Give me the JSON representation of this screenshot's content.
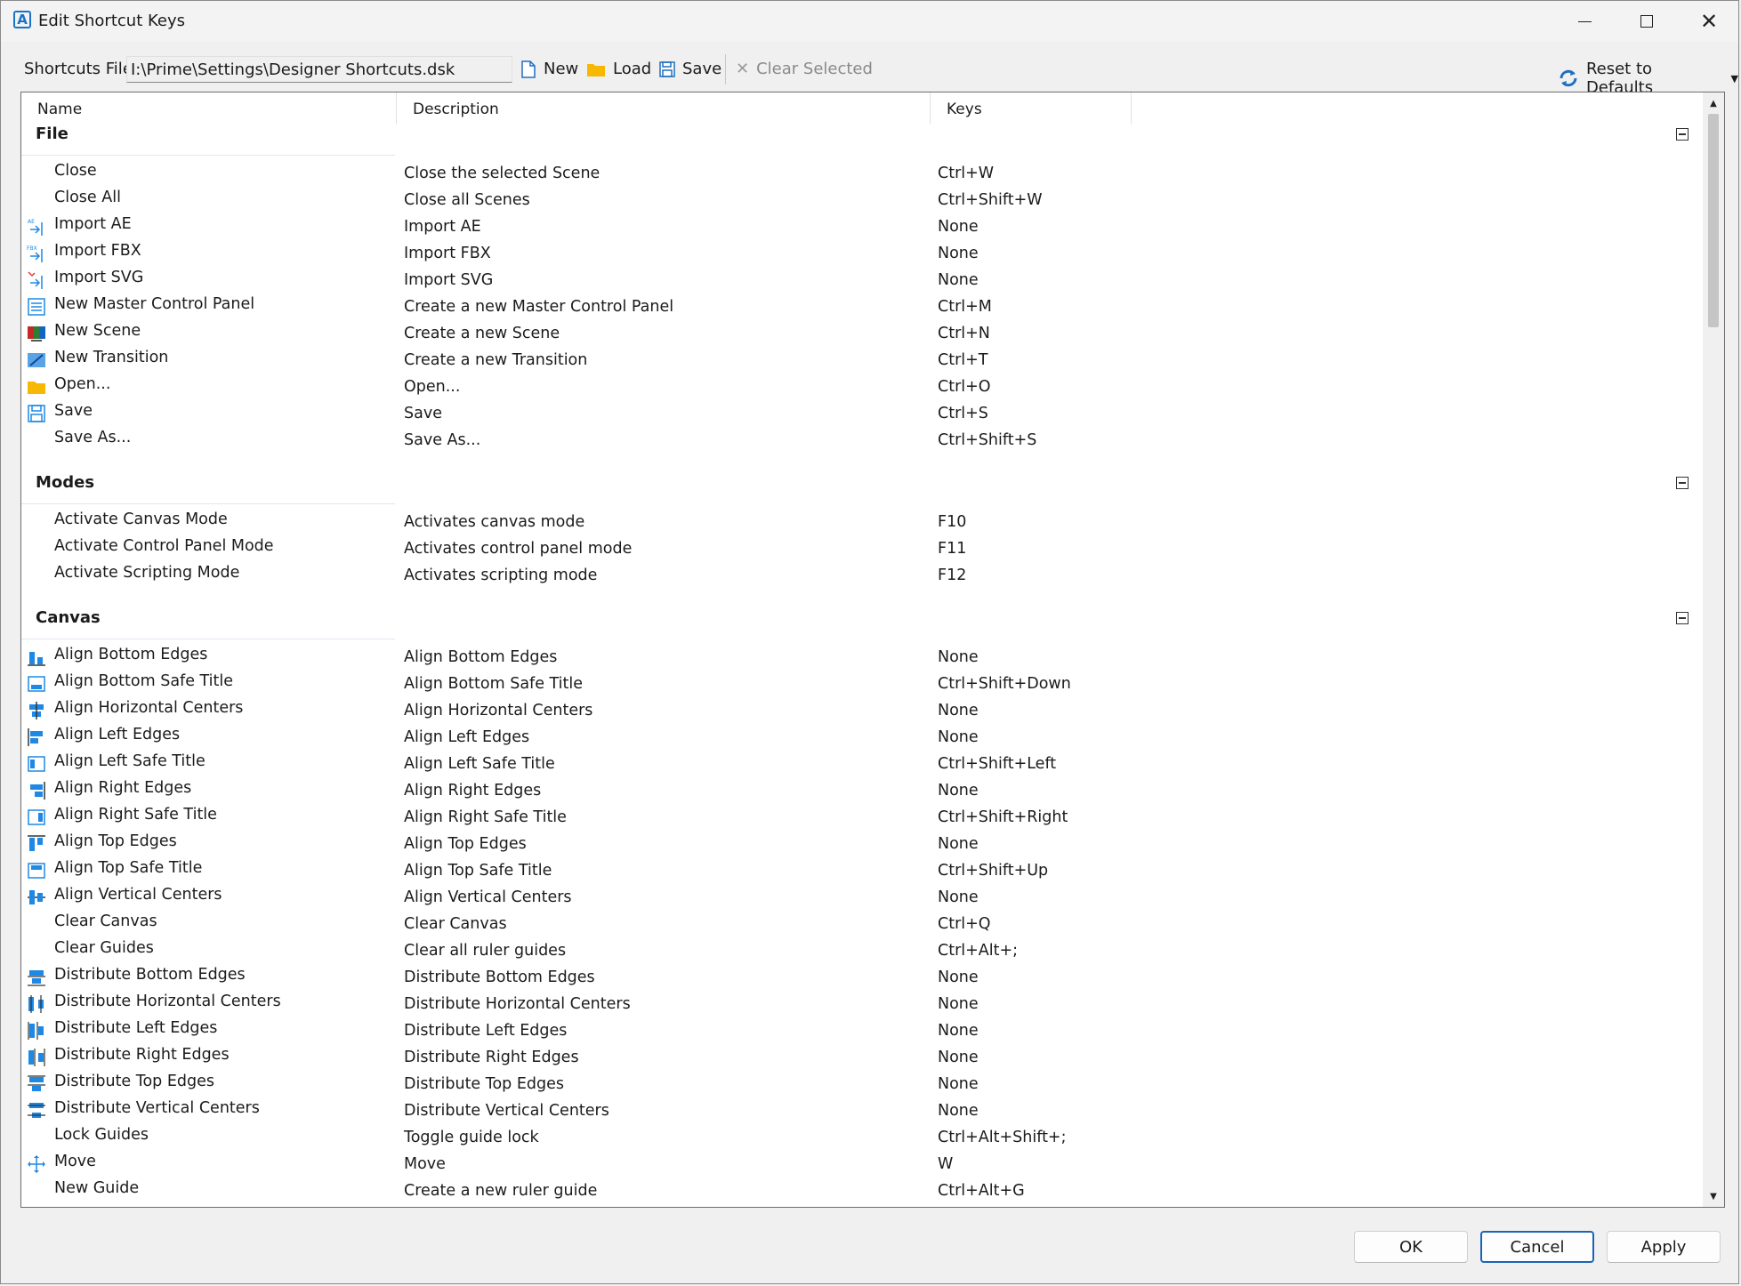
{
  "window": {
    "title": "Edit Shortcut Keys"
  },
  "toolbar": {
    "shortcuts_file_label": "Shortcuts File",
    "shortcuts_file_value": "I:\\Prime\\Settings\\Designer Shortcuts.dsk",
    "new_label": "New",
    "load_label": "Load",
    "save_label": "Save",
    "clear_selected_label": "Clear Selected",
    "reset_label": "Reset to Defaults"
  },
  "columns": {
    "name": "Name",
    "description": "Description",
    "keys": "Keys"
  },
  "groups": [
    {
      "title": "File",
      "rows": [
        {
          "icon": "",
          "name": "Close",
          "description": "Close the selected Scene",
          "keys": "Ctrl+W"
        },
        {
          "icon": "",
          "name": "Close All",
          "description": "Close all Scenes",
          "keys": "Ctrl+Shift+W"
        },
        {
          "icon": "import-ae-icon",
          "name": "Import AE",
          "description": "Import AE",
          "keys": "None"
        },
        {
          "icon": "import-fbx-icon",
          "name": "Import FBX",
          "description": "Import FBX",
          "keys": "None"
        },
        {
          "icon": "import-svg-icon",
          "name": "Import SVG",
          "description": "Import SVG",
          "keys": "None"
        },
        {
          "icon": "control-panel-icon",
          "name": "New Master Control Panel",
          "description": "Create a new Master Control Panel",
          "keys": "Ctrl+M"
        },
        {
          "icon": "scene-icon",
          "name": "New Scene",
          "description": "Create a new Scene",
          "keys": "Ctrl+N"
        },
        {
          "icon": "transition-icon",
          "name": "New Transition",
          "description": "Create a new Transition",
          "keys": "Ctrl+T"
        },
        {
          "icon": "folder-icon",
          "name": "Open...",
          "description": "Open...",
          "keys": "Ctrl+O"
        },
        {
          "icon": "save-icon",
          "name": "Save",
          "description": "Save",
          "keys": "Ctrl+S"
        },
        {
          "icon": "",
          "name": "Save As...",
          "description": "Save As...",
          "keys": "Ctrl+Shift+S"
        }
      ]
    },
    {
      "title": "Modes",
      "rows": [
        {
          "icon": "",
          "name": "Activate Canvas Mode",
          "description": "Activates canvas mode",
          "keys": "F10"
        },
        {
          "icon": "",
          "name": "Activate Control Panel Mode",
          "description": "Activates control panel mode",
          "keys": "F11"
        },
        {
          "icon": "",
          "name": "Activate Scripting Mode",
          "description": "Activates scripting mode",
          "keys": "F12"
        }
      ]
    },
    {
      "title": "Canvas",
      "rows": [
        {
          "icon": "align-bottom-edges-icon",
          "name": "Align Bottom Edges",
          "description": "Align Bottom Edges",
          "keys": "None"
        },
        {
          "icon": "align-bottom-safe-title-icon",
          "name": "Align Bottom Safe Title",
          "description": "Align Bottom Safe Title",
          "keys": "Ctrl+Shift+Down"
        },
        {
          "icon": "align-horizontal-centers-icon",
          "name": "Align Horizontal Centers",
          "description": "Align Horizontal Centers",
          "keys": "None"
        },
        {
          "icon": "align-left-edges-icon",
          "name": "Align Left Edges",
          "description": "Align Left Edges",
          "keys": "None"
        },
        {
          "icon": "align-left-safe-title-icon",
          "name": "Align Left Safe Title",
          "description": "Align Left Safe Title",
          "keys": "Ctrl+Shift+Left"
        },
        {
          "icon": "align-right-edges-icon",
          "name": "Align Right Edges",
          "description": "Align Right Edges",
          "keys": "None"
        },
        {
          "icon": "align-right-safe-title-icon",
          "name": "Align Right Safe Title",
          "description": "Align Right Safe Title",
          "keys": "Ctrl+Shift+Right"
        },
        {
          "icon": "align-top-edges-icon",
          "name": "Align Top Edges",
          "description": "Align Top Edges",
          "keys": "None"
        },
        {
          "icon": "align-top-safe-title-icon",
          "name": "Align Top Safe Title",
          "description": "Align Top Safe Title",
          "keys": "Ctrl+Shift+Up"
        },
        {
          "icon": "align-vertical-centers-icon",
          "name": "Align Vertical Centers",
          "description": "Align Vertical Centers",
          "keys": "None"
        },
        {
          "icon": "",
          "name": "Clear Canvas",
          "description": "Clear Canvas",
          "keys": "Ctrl+Q"
        },
        {
          "icon": "",
          "name": "Clear Guides",
          "description": "Clear all ruler guides",
          "keys": "Ctrl+Alt+;"
        },
        {
          "icon": "distribute-bottom-edges-icon",
          "name": "Distribute Bottom Edges",
          "description": "Distribute Bottom Edges",
          "keys": "None"
        },
        {
          "icon": "distribute-horizontal-centers-icon",
          "name": "Distribute Horizontal Centers",
          "description": "Distribute Horizontal Centers",
          "keys": "None"
        },
        {
          "icon": "distribute-left-edges-icon",
          "name": "Distribute Left Edges",
          "description": "Distribute Left Edges",
          "keys": "None"
        },
        {
          "icon": "distribute-right-edges-icon",
          "name": "Distribute Right Edges",
          "description": "Distribute Right Edges",
          "keys": "None"
        },
        {
          "icon": "distribute-top-edges-icon",
          "name": "Distribute Top Edges",
          "description": "Distribute Top Edges",
          "keys": "None"
        },
        {
          "icon": "distribute-vertical-centers-icon",
          "name": "Distribute Vertical Centers",
          "description": "Distribute Vertical Centers",
          "keys": "None"
        },
        {
          "icon": "",
          "name": "Lock Guides",
          "description": "Toggle guide lock",
          "keys": "Ctrl+Alt+Shift+;"
        },
        {
          "icon": "move-icon",
          "name": "Move",
          "description": "Move",
          "keys": "W"
        },
        {
          "icon": "",
          "name": "New Guide",
          "description": "Create a new ruler guide",
          "keys": "Ctrl+Alt+G"
        }
      ]
    }
  ],
  "footer": {
    "ok_label": "OK",
    "cancel_label": "Cancel",
    "apply_label": "Apply"
  },
  "colors": {
    "accent": "#1a73c9",
    "icon_blue": "#1e88e5",
    "folder": "#f6b800"
  }
}
